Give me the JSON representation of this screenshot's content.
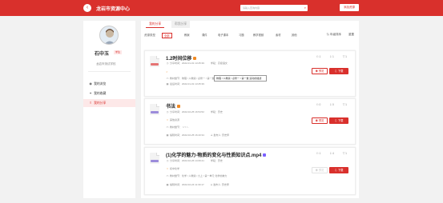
{
  "header": {
    "title": "龙岩市资源中心",
    "search_placeholder": "请输入查询内容",
    "new_button": "添加资源"
  },
  "sidebar": {
    "user_name": "石中玉",
    "user_tag": "学生",
    "school": "龙岩市测试学校",
    "items": [
      {
        "label": "我的浏览",
        "icon": "eye-icon",
        "active": false
      },
      {
        "label": "我的收藏",
        "icon": "pin-icon",
        "active": false
      },
      {
        "label": "我的分享",
        "icon": "share-icon",
        "active": true
      }
    ]
  },
  "tabs": [
    {
      "label": "我的分享",
      "selected": true
    },
    {
      "label": "帮我分享",
      "selected": false
    }
  ],
  "filters": {
    "label": "资源类型",
    "options": [
      "全部",
      "教案",
      "课件",
      "电子课本",
      "习题",
      "教学视频",
      "素材",
      "其他"
    ],
    "selected": "全部",
    "sort_label": "年级排序",
    "reset_label": "重置"
  },
  "cards": [
    {
      "title": "1.2时间位移",
      "badge_color": "#f08a24",
      "thumb_tag_color": "#e57373",
      "share_time": "分享时间：2022-01-01 13:25:39",
      "subject": "学段：高级语文",
      "chapter": "教材章节：物理 / 人教版 / 必修一 / 第一章 运动的描述",
      "last_time": "最后时间：2022-01-01 13:25:39",
      "stats": {
        "views": "1",
        "downloads": "1",
        "likes": "1"
      },
      "preview": "预览",
      "download": "下载",
      "tooltip": "物理 / 人教版 / 必修一 / 第一章 运动的描述"
    },
    {
      "title": "书法",
      "badge_color": "#f08a24",
      "thumb_tag_color": "#9c8cdb",
      "share_time": "分享时间：2022-02-25 16:54:52",
      "subject": "学段：历史",
      "description": "其他资源",
      "chapter": "教材章节： / / / / -",
      "last_time": "编辑时间：2022-02-25 16:43:34",
      "owner": "发布人: 历史师",
      "stats": {
        "views": "0",
        "downloads": "0",
        "likes": "1"
      },
      "preview": "预览",
      "download": "下载"
    },
    {
      "title": "(1)化学的魅力-物质的变化与性质知识点.mp4",
      "badge_color": "#7b61ff",
      "thumb_tag_color": "#9c8cdb",
      "share_time": "分享时间：2022-02-26 14:09:41",
      "subject": "学段：历史",
      "description": "初中化学",
      "chapter": "教材章节：化学 / 人教版 / 九上 / 第一单元 化学的魅力",
      "last_time": "编辑时间：2022-02-24 11:30:17",
      "owner": "发布人: 历史师",
      "stats": {
        "views": "1",
        "downloads": "4",
        "likes": "1"
      },
      "preview": "预览",
      "download": "下载"
    }
  ]
}
